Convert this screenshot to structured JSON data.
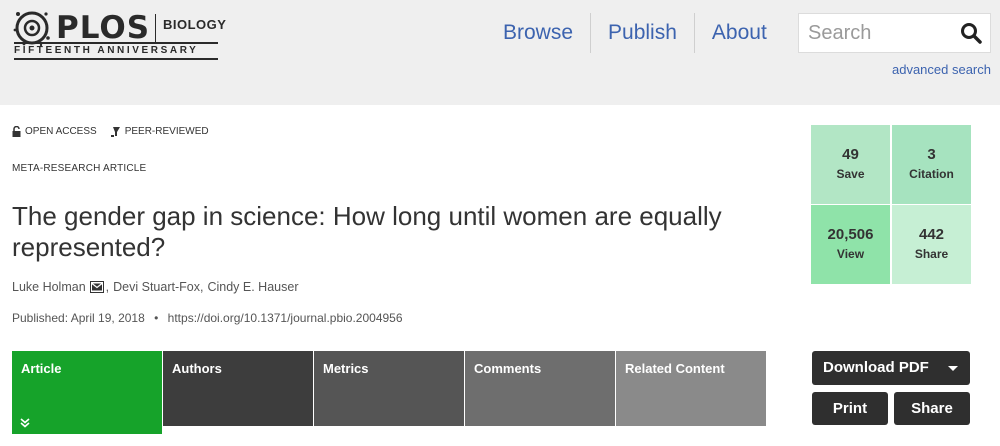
{
  "brand": {
    "name": "PLOS",
    "journal": "BIOLOGY",
    "tagline": "FIFTEENTH ANNIVERSARY"
  },
  "nav": {
    "browse": "Browse",
    "publish": "Publish",
    "about": "About"
  },
  "search": {
    "placeholder": "Search",
    "advanced": "advanced search"
  },
  "article": {
    "flags": {
      "open_access": "OPEN ACCESS",
      "peer_reviewed": "PEER-REVIEWED"
    },
    "type": "META-RESEARCH ARTICLE",
    "title": "The gender gap in science: How long until women are equally represented?",
    "authors": [
      "Luke Holman",
      "Devi Stuart-Fox",
      "Cindy E. Hauser"
    ],
    "author_separator": ",",
    "published_label": "Published:",
    "published_date": "April 19, 2018",
    "doi": "https://doi.org/10.1371/journal.pbio.2004956"
  },
  "tabs": [
    {
      "label": "Article",
      "color": "#16a32a",
      "active": true
    },
    {
      "label": "Authors",
      "color": "#3d3d3d",
      "active": false
    },
    {
      "label": "Metrics",
      "color": "#555555",
      "active": false
    },
    {
      "label": "Comments",
      "color": "#6e6e6e",
      "active": false
    },
    {
      "label": "Related Content",
      "color": "#8a8a8a",
      "active": false
    }
  ],
  "metrics": {
    "save": {
      "value": "49",
      "label": "Save",
      "color": "#b2e6c5"
    },
    "citation": {
      "value": "3",
      "label": "Citation",
      "color": "#a6e3bf"
    },
    "view": {
      "value": "20,506",
      "label": "View",
      "color": "#8fe3a9"
    },
    "share": {
      "value": "442",
      "label": "Share",
      "color": "#c6efd4"
    }
  },
  "actions": {
    "download": "Download PDF",
    "print": "Print",
    "share": "Share"
  },
  "colors": {
    "header_bg": "#efefef",
    "link_blue": "#3c63af",
    "dark_button": "#2f2f2f"
  }
}
